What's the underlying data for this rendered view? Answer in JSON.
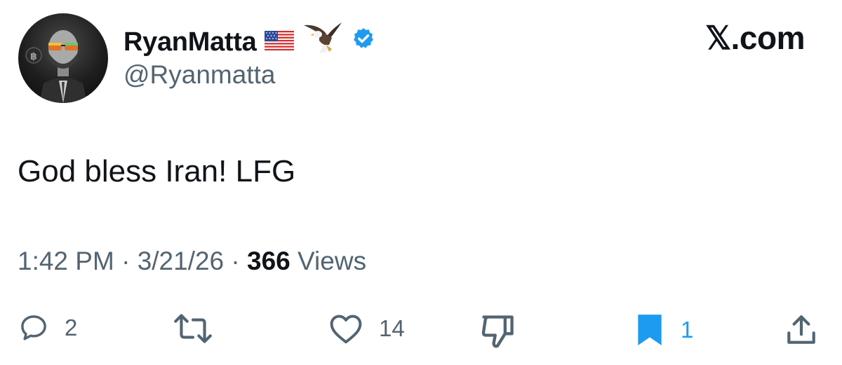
{
  "author": {
    "display_name": "RyanMatta",
    "handle": "@Ryanmatta",
    "badges": [
      "us-flag-icon",
      "eagle-icon",
      "verified-badge-icon"
    ]
  },
  "brand": "𝕏.com",
  "tweet": {
    "text": "God bless Iran! LFG",
    "time": "1:42 PM",
    "date": "3/21/26",
    "views_count": "366",
    "views_label": "Views"
  },
  "actions": {
    "replies": "2",
    "reposts": "",
    "likes": "14",
    "bookmarks": "1"
  },
  "colors": {
    "text": "#0f1419",
    "secondary": "#536471",
    "accent": "#1d9bf0"
  }
}
